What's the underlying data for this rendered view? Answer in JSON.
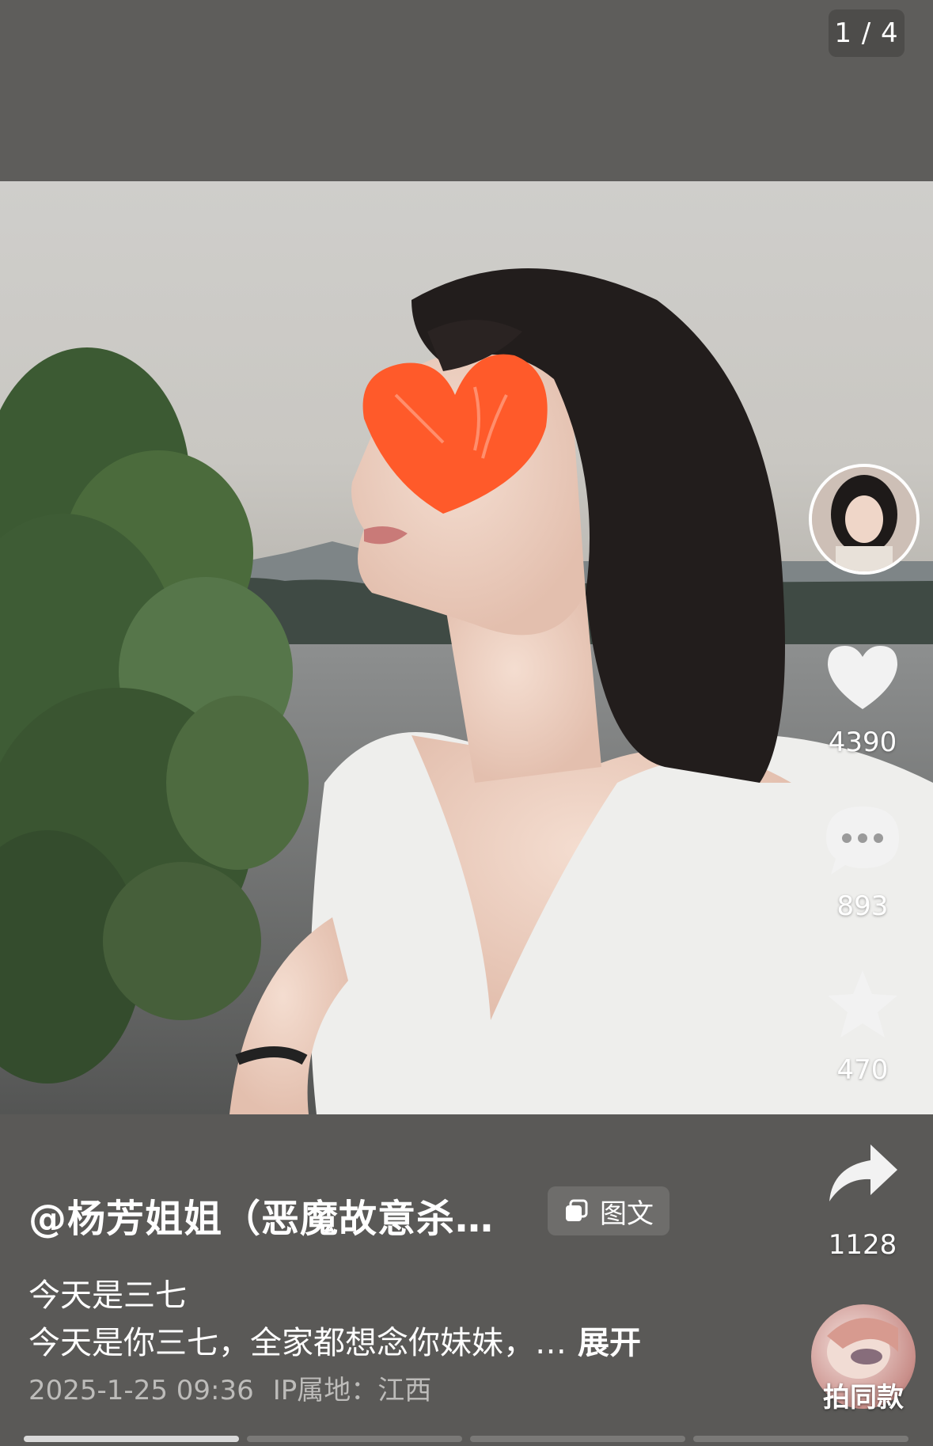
{
  "pager": {
    "counter": "1 / 4",
    "total": 4,
    "current": 1
  },
  "author": {
    "name": "@杨芳姐姐（恶魔故意杀…"
  },
  "post_type_badge": "图文",
  "caption": {
    "line1": "今天是三七",
    "line2": "今天是你三七，全家都想念你妹妹，…",
    "expand_label": "展开"
  },
  "meta": {
    "date": "2025-1-25 09:36",
    "ip_location": "IP属地：江西"
  },
  "actions": {
    "likes": "4390",
    "comments": "893",
    "favorites": "470",
    "shares": "1128",
    "same_style_label": "拍同款"
  },
  "icons": {
    "like": "heart-icon",
    "comment": "comment-bubble-icon",
    "favorite": "star-icon",
    "share": "share-arrow-icon",
    "badge": "gallery-icon"
  },
  "colors": {
    "background": "#5f5e5c",
    "heart_sticker": "#ff5a2a",
    "active_progress": "#d9d9d9",
    "inactive_progress": "#7a7977"
  }
}
